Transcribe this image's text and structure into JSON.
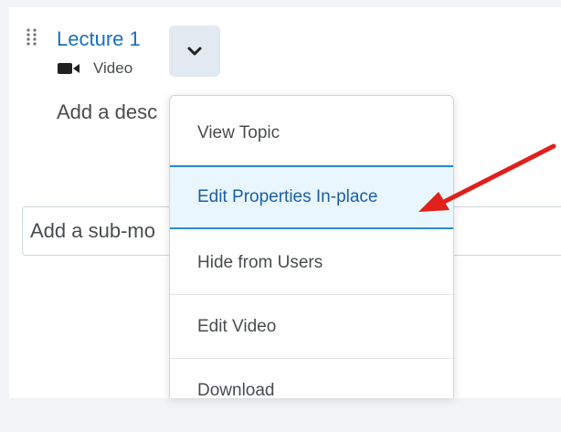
{
  "topic": {
    "title": "Lecture 1",
    "type_label": "Video",
    "type_icon": "video-camera-icon",
    "description_placeholder": "Add a desc"
  },
  "actions_button": {
    "icon": "chevron-down-icon"
  },
  "submodule": {
    "placeholder": "Add a sub-mo"
  },
  "context_menu": {
    "items": [
      {
        "label": "View Topic"
      },
      {
        "label": "Edit Properties In-place",
        "highlighted": true
      },
      {
        "label": "Hide from Users"
      },
      {
        "label": "Edit Video"
      },
      {
        "label": "Download"
      }
    ]
  },
  "colors": {
    "link": "#1a6fc2",
    "highlight_bg": "#e9f6fd",
    "highlight_border": "#2b8bd0",
    "annotation_arrow": "#e0201b"
  }
}
